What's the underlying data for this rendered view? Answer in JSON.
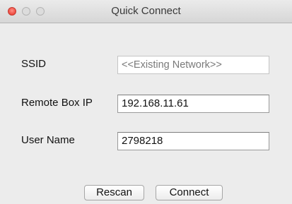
{
  "window": {
    "title": "Quick Connect"
  },
  "form": {
    "ssid": {
      "label": "SSID",
      "value": "<<Existing Network>>"
    },
    "remote_ip": {
      "label": "Remote Box IP",
      "value": "192.168.11.61"
    },
    "user_name": {
      "label": "User Name",
      "value": "2798218"
    }
  },
  "buttons": {
    "rescan": "Rescan",
    "connect": "Connect"
  },
  "colors": {
    "close_button": "#ee4a3f",
    "window_background": "#ececec"
  }
}
